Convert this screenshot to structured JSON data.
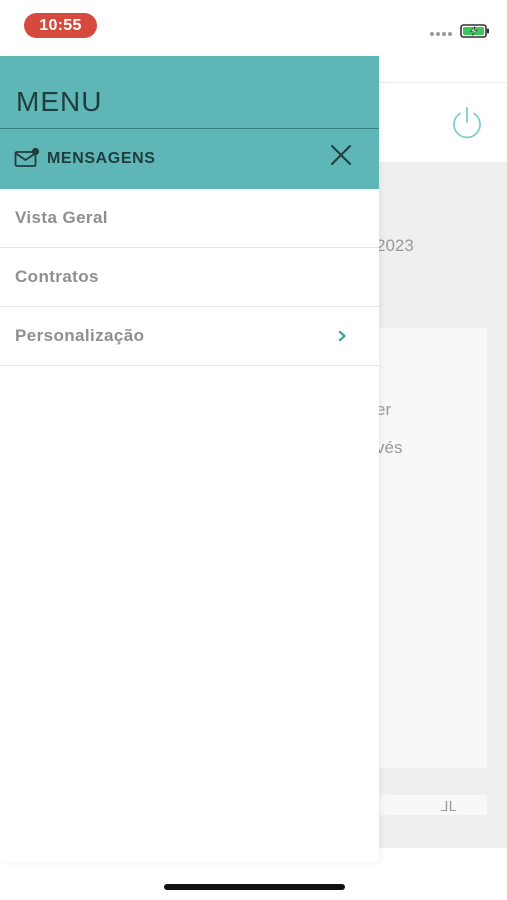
{
  "status_bar": {
    "time": "10:55",
    "time_pill_color": "#d64a3d",
    "battery_icon": "battery-charging-icon",
    "signal_icon": "signal-dots-icon"
  },
  "background_page": {
    "date_fragment": "2023",
    "text_fragment_1": "er",
    "text_fragment_2": "vés",
    "bottom_fragment": "ᒧᒪ",
    "power_icon": "power-icon"
  },
  "drawer": {
    "title": "MENU",
    "header_color": "#5fb6b6",
    "messages": {
      "label": "MENSAGENS",
      "icon": "mail-notification-icon"
    },
    "close_icon": "close-icon",
    "items": [
      {
        "label": "Vista Geral",
        "has_chevron": false
      },
      {
        "label": "Contratos",
        "has_chevron": false
      },
      {
        "label": "Personalização",
        "has_chevron": true
      }
    ],
    "chevron_color": "#3fa7a8"
  }
}
